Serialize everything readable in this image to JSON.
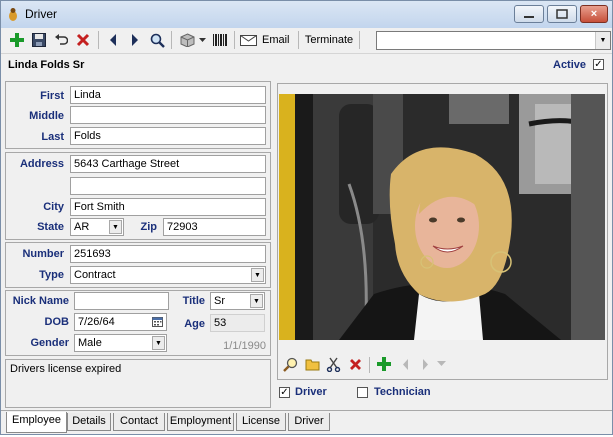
{
  "window": {
    "title": "Driver",
    "close_glyph": "×"
  },
  "toolbar": {
    "email_label": "Email",
    "terminate_label": "Terminate",
    "icons": [
      "add-icon",
      "save-icon",
      "undo-icon",
      "delete-icon",
      "prev-icon",
      "next-icon",
      "find-icon",
      "cube-icon",
      "dropdown-icon",
      "barcode-icon",
      "email-icon"
    ]
  },
  "header": {
    "name": "Linda Folds Sr",
    "active_label": "Active",
    "active_checked": "✓"
  },
  "name_group": {
    "first_label": "First",
    "first_value": "Linda",
    "middle_label": "Middle",
    "middle_value": "",
    "last_label": "Last",
    "last_value": "Folds"
  },
  "address_group": {
    "address_label": "Address",
    "address1": "5643 Carthage Street",
    "address2": "",
    "city_label": "City",
    "city_value": "Fort Smith",
    "state_label": "State",
    "state_value": "AR",
    "zip_label": "Zip",
    "zip_value": "72903"
  },
  "number_group": {
    "number_label": "Number",
    "number_value": "251693",
    "type_label": "Type",
    "type_value": "Contract"
  },
  "personal_group": {
    "nick_label": "Nick Name",
    "nick_value": "",
    "title_label": "Title",
    "title_value": "Sr",
    "dob_label": "DOB",
    "dob_value": "7/26/64",
    "age_label": "Age",
    "age_value": "53",
    "gender_label": "Gender",
    "gender_value": "Male",
    "date_note": "1/1/1990"
  },
  "notes": {
    "text": "Drivers license expired"
  },
  "roles": {
    "driver_label": "Driver",
    "driver_checked": "✓",
    "technician_label": "Technician",
    "technician_checked": ""
  },
  "tabs": [
    {
      "label": "Employee"
    },
    {
      "label": "Details"
    },
    {
      "label": "Contact"
    },
    {
      "label": "Employment"
    },
    {
      "label": "License"
    },
    {
      "label": "Driver"
    }
  ],
  "colors": {
    "label_blue": "#1a2f7a",
    "add_green": "#1a9a2a",
    "delete_red": "#c42020"
  }
}
